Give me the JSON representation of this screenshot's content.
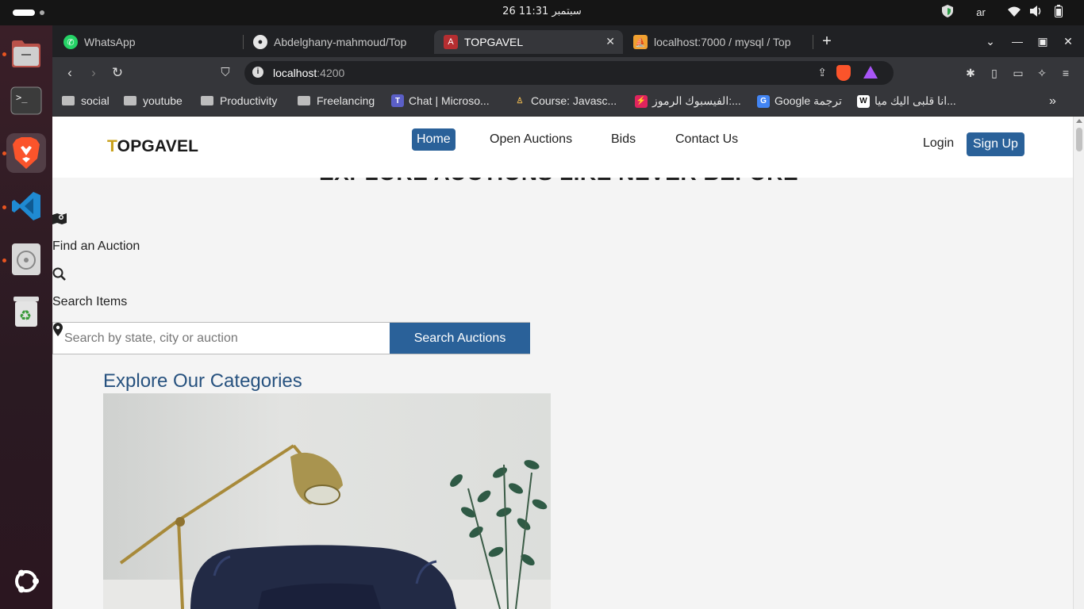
{
  "system": {
    "clock": "26 سبتمبر  11:31",
    "language": "ar"
  },
  "tabs": [
    {
      "label": "WhatsApp",
      "icon": "whatsapp-icon"
    },
    {
      "label": "Abdelghany-mahmoud/Top",
      "icon": "github-icon"
    },
    {
      "label": "TOPGAVEL",
      "icon": "angular-icon"
    },
    {
      "label": "localhost:7000 / mysql / Top",
      "icon": "phpmyadmin-icon"
    }
  ],
  "address": {
    "host": "localhost",
    "port": ":4200"
  },
  "bookmarks": [
    {
      "label": "social",
      "type": "folder"
    },
    {
      "label": "youtube",
      "type": "folder"
    },
    {
      "label": "Productivity",
      "type": "folder"
    },
    {
      "label": "Freelancing",
      "type": "folder"
    },
    {
      "label": "Chat | Microso...",
      "type": "link"
    },
    {
      "label": "Course: Javasc...",
      "type": "link"
    },
    {
      "label": "الفيسبوك الرموز:...",
      "type": "link"
    },
    {
      "label": "Google ترجمة",
      "type": "link"
    },
    {
      "label": "انا قلبى اليك ميا...",
      "type": "link"
    }
  ],
  "site": {
    "logo_first": "T",
    "logo_rest": "OPGAVEL",
    "nav": [
      "Home",
      "Open Auctions",
      "Bids",
      "Contact Us"
    ],
    "login": "Login",
    "signup": "Sign Up",
    "hero_title": "EXPLORE AUCTIONS LIKE NEVER BEFORE",
    "find_auction": "Find an Auction",
    "search_items": "Search Items",
    "search_placeholder": "Search by state, city or auction",
    "search_button": "Search Auctions",
    "categories_title": "Explore Our Categories"
  },
  "colors": {
    "brand_blue": "#2a6199",
    "logo_gold": "#c8a019",
    "heading_blue": "#27527f"
  }
}
